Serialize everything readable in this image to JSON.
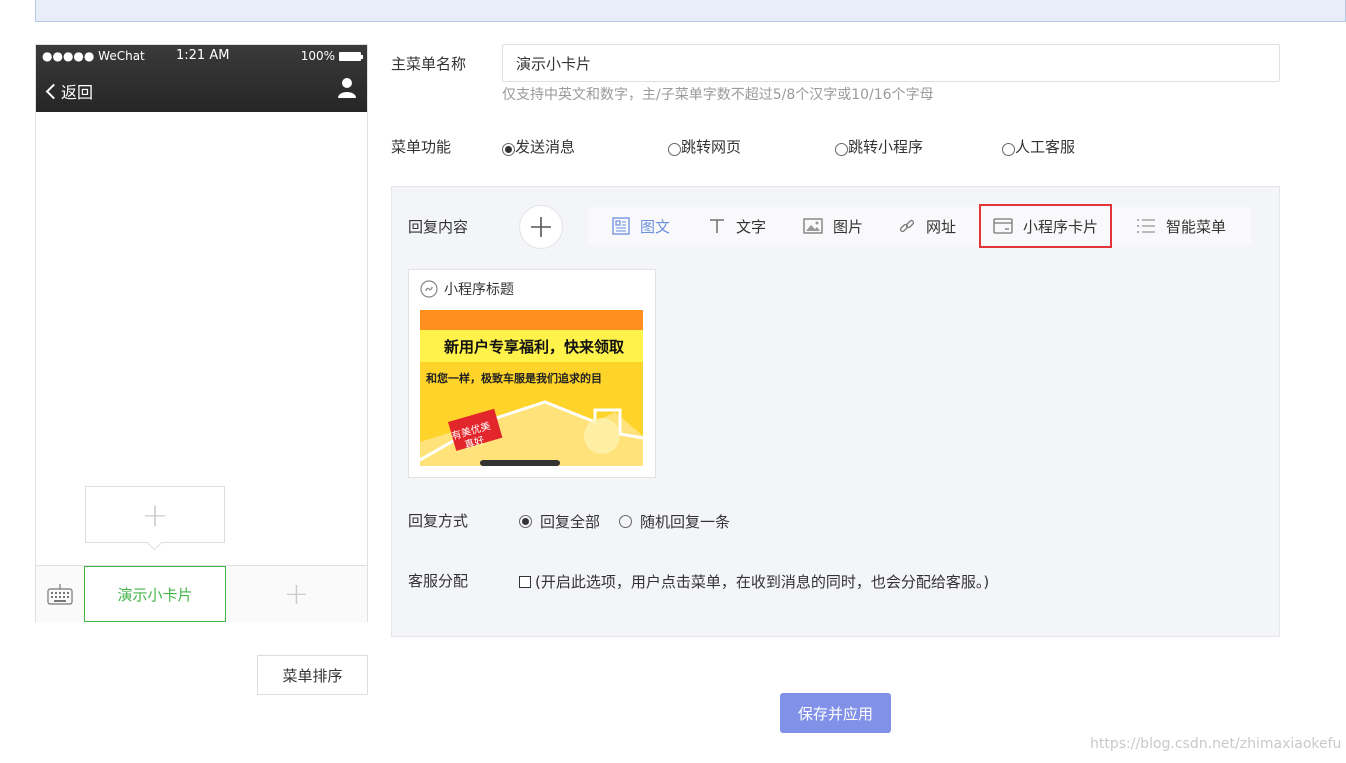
{
  "phone": {
    "carrier": "●●●●● WeChat",
    "time": "1:21 AM",
    "battery": "100%",
    "back_label": "返回",
    "menu_active_label": "演示小卡片",
    "sort_button": "菜单排序"
  },
  "form": {
    "name_label": "主菜单名称",
    "name_value": "演示小卡片",
    "name_hint": "仅支持中英文和数字，主/子菜单字数不超过5/8个汉字或10/16个字母",
    "function_label": "菜单功能",
    "function_options": [
      "发送消息",
      "跳转网页",
      "跳转小程序",
      "人工客服"
    ],
    "function_selected": "发送消息"
  },
  "reply": {
    "content_label": "回复内容",
    "tabs": [
      "图文",
      "文字",
      "图片",
      "网址",
      "小程序卡片",
      "智能菜单"
    ],
    "active_tab": "图文",
    "highlighted_tab": "小程序卡片",
    "card": {
      "title": "小程序标题",
      "banner_headline": "新用户专享福利，快来领取",
      "banner_sub": "和您一样，极致车服是我们追求的目",
      "banner_tag_line1": "有美优美",
      "banner_tag_line2": "真好"
    },
    "mode_label": "回复方式",
    "mode_options": [
      "回复全部",
      "随机回复一条"
    ],
    "mode_selected": "回复全部",
    "service_label": "客服分配",
    "service_text": "(开启此选项，用户点击菜单，在收到消息的同时，也会分配给客服。)"
  },
  "save_button": "保存并应用",
  "watermark": "https://blog.csdn.net/zhimaxiaokefu",
  "colors": {
    "accent_green": "#44b549",
    "tab_active": "#6c8fdd",
    "highlight_red": "#e3343a",
    "save_button_bg": "#8291e8",
    "panel_bg": "#f4f5f9"
  }
}
